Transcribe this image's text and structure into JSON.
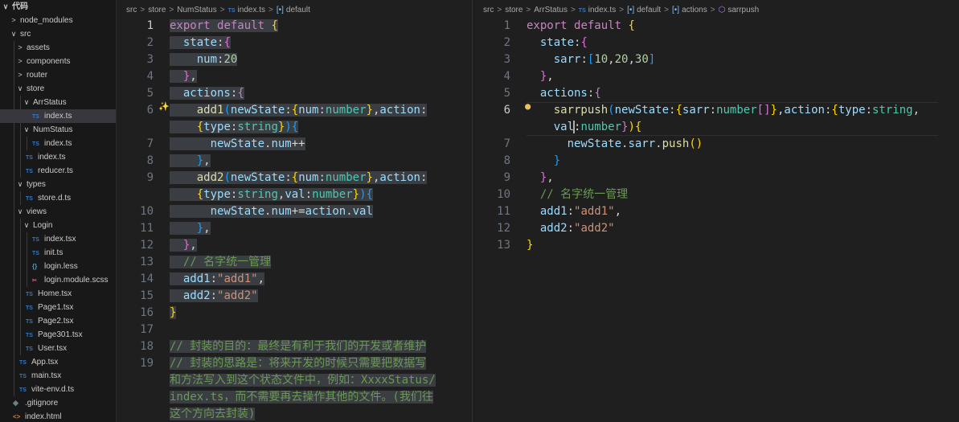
{
  "sidebar": {
    "root": "代码",
    "items": [
      {
        "label": "node_modules",
        "kind": "folder",
        "depth": 1,
        "open": false
      },
      {
        "label": "src",
        "kind": "folder",
        "depth": 1,
        "open": true
      },
      {
        "label": "assets",
        "kind": "folder",
        "depth": 2,
        "open": false
      },
      {
        "label": "components",
        "kind": "folder",
        "depth": 2,
        "open": false
      },
      {
        "label": "router",
        "kind": "folder",
        "depth": 2,
        "open": false
      },
      {
        "label": "store",
        "kind": "folder",
        "depth": 2,
        "open": true
      },
      {
        "label": "ArrStatus",
        "kind": "folder",
        "depth": 3,
        "open": true
      },
      {
        "label": "index.ts",
        "kind": "ts",
        "depth": 4,
        "active": true
      },
      {
        "label": "NumStatus",
        "kind": "folder",
        "depth": 3,
        "open": true
      },
      {
        "label": "index.ts",
        "kind": "ts",
        "depth": 4
      },
      {
        "label": "index.ts",
        "kind": "ts",
        "depth": 3
      },
      {
        "label": "reducer.ts",
        "kind": "ts",
        "depth": 3
      },
      {
        "label": "types",
        "kind": "folder",
        "depth": 2,
        "open": true
      },
      {
        "label": "store.d.ts",
        "kind": "ts",
        "depth": 3
      },
      {
        "label": "views",
        "kind": "folder",
        "depth": 2,
        "open": true
      },
      {
        "label": "Login",
        "kind": "folder",
        "depth": 3,
        "open": true
      },
      {
        "label": "index.tsx",
        "kind": "ts",
        "depth": 4
      },
      {
        "label": "init.ts",
        "kind": "ts",
        "depth": 4
      },
      {
        "label": "login.less",
        "kind": "less",
        "depth": 4
      },
      {
        "label": "login.module.scss",
        "kind": "scss",
        "depth": 4
      },
      {
        "label": "Home.tsx",
        "kind": "ts",
        "depth": 3
      },
      {
        "label": "Page1.tsx",
        "kind": "ts",
        "depth": 3
      },
      {
        "label": "Page2.tsx",
        "kind": "ts",
        "depth": 3
      },
      {
        "label": "Page301.tsx",
        "kind": "ts",
        "depth": 3
      },
      {
        "label": "User.tsx",
        "kind": "ts",
        "depth": 3
      },
      {
        "label": "App.tsx",
        "kind": "ts",
        "depth": 2
      },
      {
        "label": "main.tsx",
        "kind": "ts",
        "depth": 2
      },
      {
        "label": "vite-env.d.ts",
        "kind": "ts",
        "depth": 2
      },
      {
        "label": ".gitignore",
        "kind": "git",
        "depth": 1
      },
      {
        "label": "index.html",
        "kind": "html",
        "depth": 1
      }
    ]
  },
  "icons": {
    "ts": "TS",
    "less": "{}",
    "scss": "✂",
    "git": "◆",
    "html": "<>",
    "chevron_open": "∨",
    "chevron_closed": ">",
    "lightbulb": "💡",
    "lightbulb_left": "✨",
    "symbol": "[•]",
    "method": "⬡"
  },
  "left_editor": {
    "breadcrumb": [
      "src",
      "store",
      "NumStatus",
      "index.ts",
      "default"
    ],
    "line_numbers": [
      "1",
      "2",
      "3",
      "4",
      "5",
      "6",
      "7",
      "8",
      "9",
      "10",
      "11",
      "12",
      "13",
      "14",
      "15",
      "16",
      "17",
      "18",
      "19"
    ],
    "current_line": "1",
    "lines": [
      "export default {",
      "  state:{",
      "    num:20",
      "  },",
      "  actions:{",
      "    add1(newState:{num:number},action:",
      "    {type:string}){",
      "      newState.num++",
      "    },",
      "    add2(newState:{num:number},action:",
      "    {type:string,val:number}){",
      "      newState.num+=action.val",
      "    },",
      "  },",
      "  // 名字统一管理",
      "  add1:\"add1\",",
      "  add2:\"add2\"",
      "}",
      "",
      "// 封装的目的：最终是有利于我们的开发或者维护",
      "// 封装的思路是：将来开发的时候只需要把数据写",
      "和方法写入到这个状态文件中，例如：XxxxStatus/",
      "index.ts，而不需要再去操作其他的文件。(我们往",
      "这个方向去封装)"
    ]
  },
  "right_editor": {
    "breadcrumb": [
      "src",
      "store",
      "ArrStatus",
      "index.ts",
      "default",
      "actions",
      "sarrpush"
    ],
    "line_numbers": [
      "1",
      "2",
      "3",
      "4",
      "5",
      "6",
      "7",
      "8",
      "9",
      "10",
      "11",
      "12",
      "13"
    ],
    "current_line": "6",
    "lines": [
      "export default {",
      "  state:{",
      "    sarr:[10,20,30]",
      "  },",
      "  actions:{",
      "    sarrpush(newState:{sarr:number[]},action:{type:string,",
      "    val:number}){",
      "      newState.sarr.push()",
      "    }",
      "  },",
      "  // 名字统一管理",
      "  add1:\"add1\",",
      "  add2:\"add2\"",
      "}"
    ]
  },
  "colors": {
    "keyword": "#c586c0",
    "property": "#9cdcfe",
    "function": "#dcdcaa",
    "type": "#4ec9b0",
    "number": "#b5cea8",
    "string": "#ce9178",
    "comment": "#6a9955",
    "selection": "#3a3d41"
  }
}
